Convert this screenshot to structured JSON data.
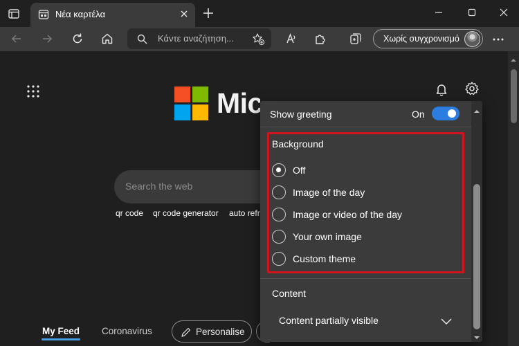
{
  "browser": {
    "tab_title": "Νέα καρτέλα",
    "address_placeholder": "Κάντε αναζήτηση...",
    "profile_label": "Χωρίς συγχρονισμό"
  },
  "icons": {
    "tab_actions": "tab-actions-icon",
    "new_tab": "plus-icon",
    "back": "back-arrow-icon",
    "forward": "forward-arrow-icon",
    "refresh": "refresh-icon",
    "home": "home-icon",
    "search": "search-icon",
    "favorite": "star-add-icon",
    "read_aloud": "read-aloud-icon",
    "extensions": "puzzle-icon",
    "collections": "collections-icon",
    "more": "more-icon",
    "apps": "app-launcher-icon",
    "notifications": "bell-icon",
    "settings": "gear-icon"
  },
  "newtab": {
    "brand": "Microsoft",
    "search_placeholder": "Search the web",
    "quick_links": [
      "qr code",
      "qr code generator",
      "auto refr"
    ],
    "feed_tabs": [
      "My Feed",
      "Coronavirus"
    ],
    "personalise_label": "Personalise"
  },
  "settings_panel": {
    "show_greeting_label": "Show greeting",
    "show_greeting_state": "On",
    "show_greeting_enabled": true,
    "background_title": "Background",
    "background_options": [
      {
        "label": "Off",
        "selected": true
      },
      {
        "label": "Image of the day",
        "selected": false
      },
      {
        "label": "Image or video of the day",
        "selected": false
      },
      {
        "label": "Your own image",
        "selected": false
      },
      {
        "label": "Custom theme",
        "selected": false
      }
    ],
    "content_title": "Content",
    "content_value": "Content partially visible"
  },
  "colors": {
    "accent": "#2b7de0",
    "highlight": "#d0131c",
    "ms_red": "#f25022",
    "ms_green": "#7fba00",
    "ms_blue": "#00a4ef",
    "ms_yellow": "#ffb900"
  }
}
